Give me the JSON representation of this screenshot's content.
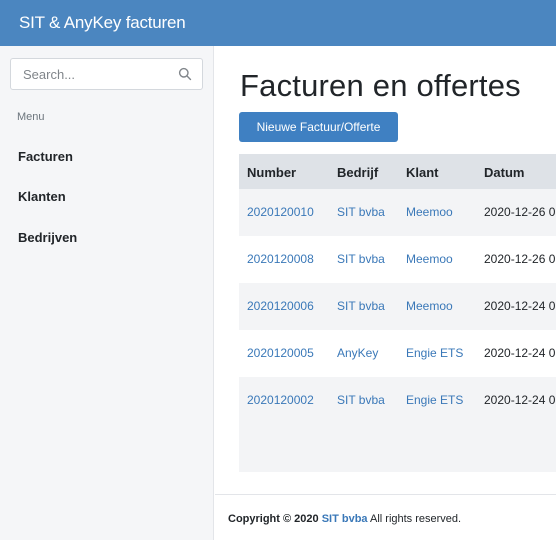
{
  "app": {
    "title": "SIT & AnyKey facturen"
  },
  "sidebar": {
    "search_placeholder": "Search...",
    "menu_label": "Menu",
    "items": [
      {
        "label": "Facturen"
      },
      {
        "label": "Klanten"
      },
      {
        "label": "Bedrijven"
      }
    ]
  },
  "main": {
    "title": "Facturen en offertes",
    "new_button": "Nieuwe Factuur/Offerte",
    "table": {
      "headers": [
        "Number",
        "Bedrijf",
        "Klant",
        "Datum"
      ],
      "rows": [
        {
          "number": "2020120010",
          "bedrijf": "SIT bvba",
          "klant": "Meemoo",
          "datum": "2020-12-26 0"
        },
        {
          "number": "2020120008",
          "bedrijf": "SIT bvba",
          "klant": "Meemoo",
          "datum": "2020-12-26 0"
        },
        {
          "number": "2020120006",
          "bedrijf": "SIT bvba",
          "klant": "Meemoo",
          "datum": "2020-12-24 0"
        },
        {
          "number": "2020120005",
          "bedrijf": "AnyKey",
          "klant": "Engie ETS",
          "datum": "2020-12-24 0"
        },
        {
          "number": "2020120002",
          "bedrijf": "SIT bvba",
          "klant": "Engie ETS",
          "datum": "2020-12-24 0"
        }
      ]
    }
  },
  "footer": {
    "copyright": "Copyright © 2020",
    "company_link": "SIT bvba",
    "rights": "All rights reserved."
  },
  "colors": {
    "topbar": "#4b86c0",
    "accent": "#3f80c2",
    "link": "#3a78b8"
  },
  "icons": {
    "search": "magnifier-icon"
  }
}
